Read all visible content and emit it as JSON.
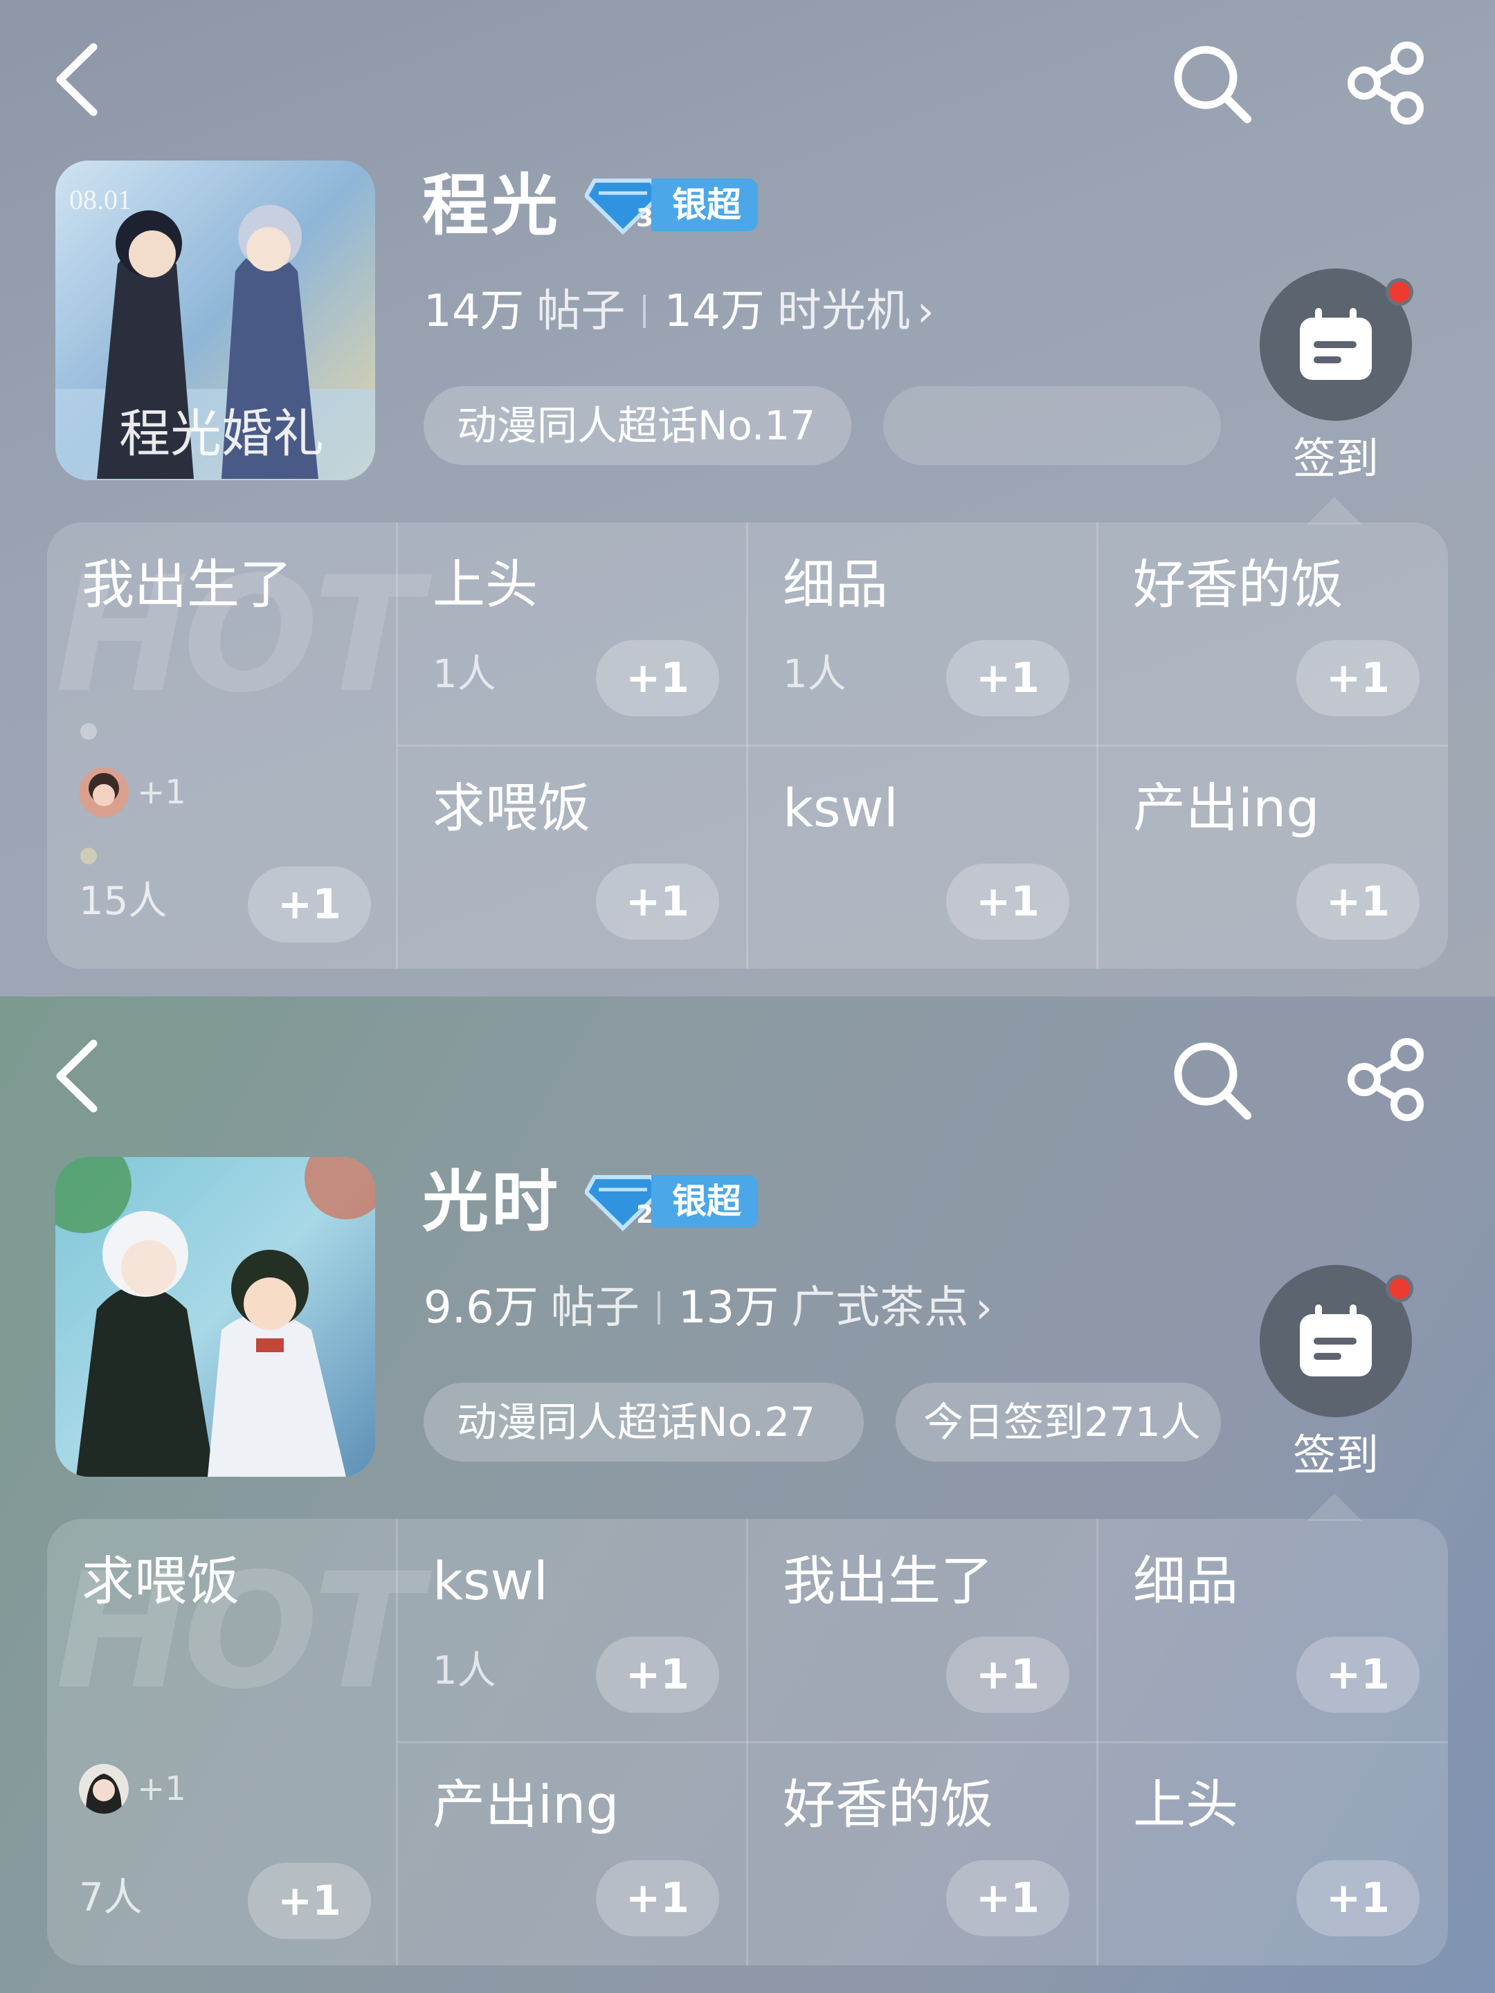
{
  "panels": [
    {
      "name": "程光",
      "level_badge": {
        "level": "3",
        "label": "银超"
      },
      "stats": {
        "posts_count": "14万",
        "posts_label": "帖子",
        "second_count": "14万",
        "second_label": "时光机",
        "chevron": "›"
      },
      "tags": [
        "动漫同人超话No.17",
        ""
      ],
      "checkin_label": "签到",
      "hot": {
        "watermark": "HOT",
        "featured": {
          "title": "我出生了",
          "avatar_plus": "+1",
          "count": "15人",
          "plus": "+1"
        },
        "cells": [
          {
            "title": "上头",
            "count": "1人",
            "plus": "+1"
          },
          {
            "title": "细品",
            "count": "1人",
            "plus": "+1"
          },
          {
            "title": "好香的饭",
            "count": "",
            "plus": "+1"
          },
          {
            "title": "求喂饭",
            "count": "",
            "plus": "+1"
          },
          {
            "title": "kswl",
            "count": "",
            "plus": "+1"
          },
          {
            "title": "产出ing",
            "count": "",
            "plus": "+1"
          }
        ]
      }
    },
    {
      "name": "光时",
      "level_badge": {
        "level": "2",
        "label": "银超"
      },
      "stats": {
        "posts_count": "9.6万",
        "posts_label": "帖子",
        "second_count": "13万",
        "second_label": "广式茶点",
        "chevron": "›"
      },
      "tags": [
        "动漫同人超话No.27",
        "今日签到271人"
      ],
      "checkin_label": "签到",
      "hot": {
        "watermark": "HOT",
        "featured": {
          "title": "求喂饭",
          "avatar_plus": "+1",
          "count": "7人",
          "plus": "+1"
        },
        "cells": [
          {
            "title": "kswl",
            "count": "1人",
            "plus": "+1"
          },
          {
            "title": "我出生了",
            "count": "",
            "plus": "+1"
          },
          {
            "title": "细品",
            "count": "",
            "plus": "+1"
          },
          {
            "title": "产出ing",
            "count": "",
            "plus": "+1"
          },
          {
            "title": "好香的饭",
            "count": "",
            "plus": "+1"
          },
          {
            "title": "上头",
            "count": "",
            "plus": "+1"
          }
        ]
      }
    }
  ],
  "icons": {
    "back": "chevron-left-icon",
    "search": "search-icon",
    "share": "share-icon",
    "checkin": "calendar-icon",
    "level": "diamond-icon"
  },
  "colors": {
    "badge_blue": "#4ba7e8",
    "notify_red": "#ee3b30",
    "checkin_bg": "#5c6470"
  }
}
